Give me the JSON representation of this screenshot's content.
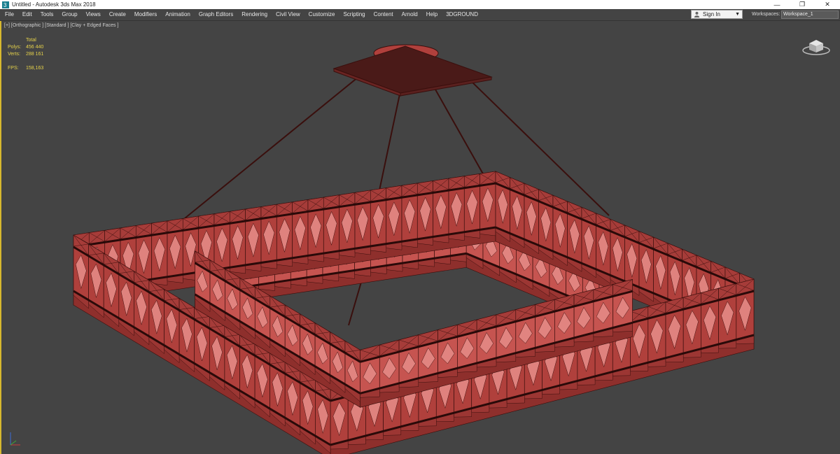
{
  "window": {
    "title": "Untitled - Autodesk 3ds Max 2018",
    "controls": {
      "minimize": "—",
      "restore": "❐",
      "close": "✕"
    }
  },
  "menu": [
    "File",
    "Edit",
    "Tools",
    "Group",
    "Views",
    "Create",
    "Modifiers",
    "Animation",
    "Graph Editors",
    "Rendering",
    "Civil View",
    "Customize",
    "Scripting",
    "Content",
    "Arnold",
    "Help",
    "3DGROUND"
  ],
  "signin": {
    "label": "Sign In"
  },
  "workspaces": {
    "label": "Workspaces:",
    "value": "Workspace_1"
  },
  "viewport": {
    "label": "[+] [Orthographic ] [Standard ] [Clay + Edged Faces ]",
    "stats": {
      "header": "Total",
      "polys_label": "Polys:",
      "polys": "456 440",
      "verts_label": "Verts:",
      "verts": "288 161",
      "fps_label": "FPS:",
      "fps": "158,163"
    }
  },
  "colors": {
    "viewport_bg": "#444444",
    "model": "#b0403c",
    "edges": "#3a0f0d",
    "stats_text": "#e6d24a",
    "active_border": "#d7b82e"
  },
  "icons": {
    "app": "3dsmax-icon",
    "user": "user-icon",
    "viewcube": "viewcube-icon",
    "axis": "axis-tripod-icon"
  }
}
